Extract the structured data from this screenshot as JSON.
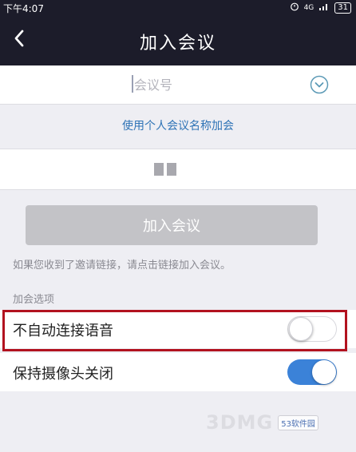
{
  "status_bar": {
    "time": "下午4:07",
    "network": "4G",
    "battery": "31"
  },
  "header": {
    "title": "加入会议",
    "back_icon": "chevron-left-icon"
  },
  "meeting_id": {
    "placeholder": "会议号",
    "value": "",
    "dropdown_icon": "chevron-down-circle-icon"
  },
  "personal_link": "使用个人会议名称加会",
  "display_name": {
    "value": ""
  },
  "join_button": "加入会议",
  "hint": "如果您收到了邀请链接，请点击链接加入会议。",
  "options_section": {
    "label": "加会选项",
    "items": [
      {
        "label": "不自动连接语音",
        "enabled": false
      },
      {
        "label": "保持摄像头关闭",
        "enabled": true
      }
    ]
  },
  "colors": {
    "header_bg": "#1c1c2a",
    "link": "#2e73b6",
    "toggle_on": "#3b82d8",
    "highlight": "#b2121f"
  },
  "watermark": {
    "text": "3DMG",
    "badge": "53软件园"
  }
}
